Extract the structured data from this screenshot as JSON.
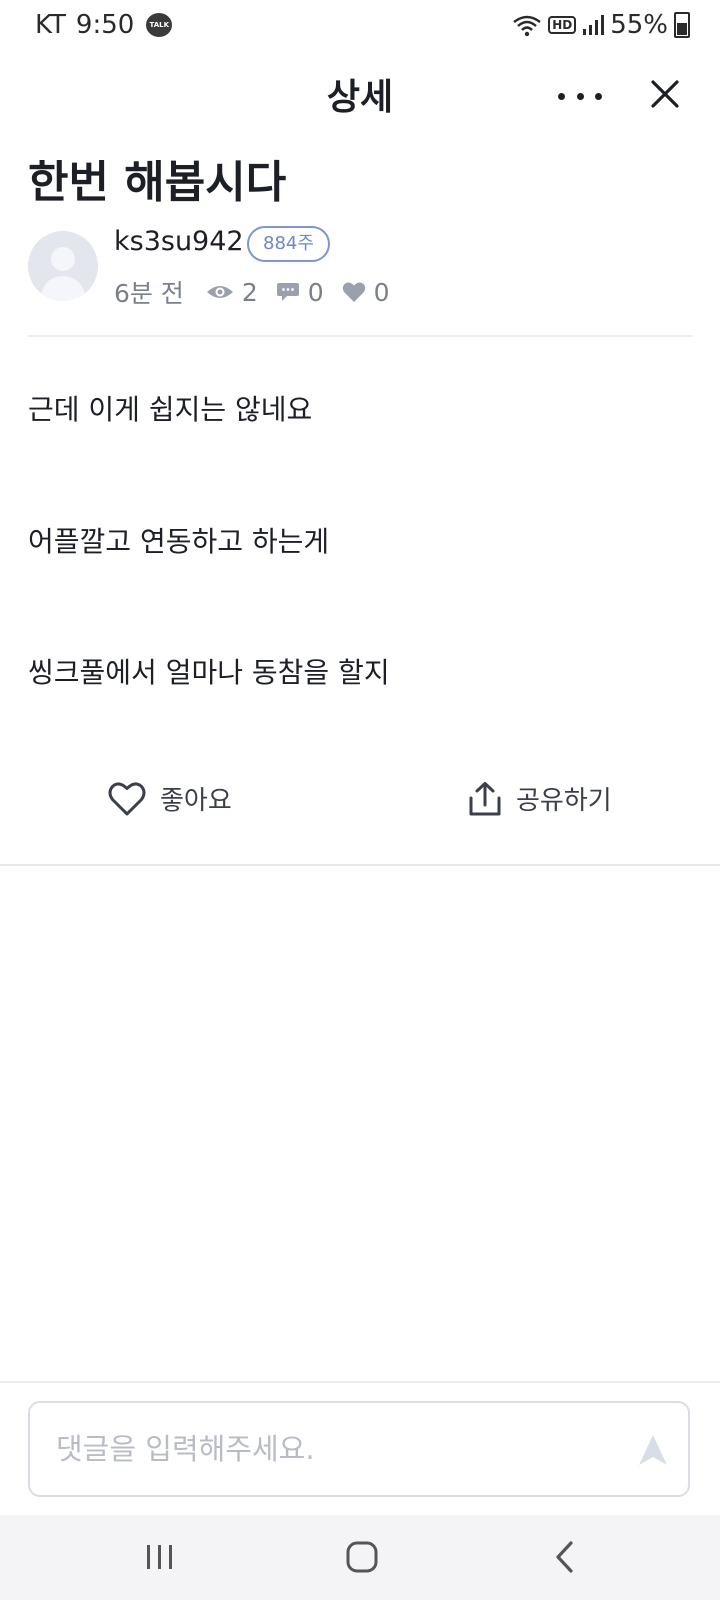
{
  "status_bar": {
    "carrier": "KT",
    "time": "9:50",
    "talk_badge": "TALK",
    "hd_label": "HD",
    "battery": "55%"
  },
  "header": {
    "title": "상세"
  },
  "post": {
    "title": "한번 해봅시다",
    "author": "ks3su942",
    "author_badge": "884주",
    "time": "6분 전",
    "views": "2",
    "comments": "0",
    "likes": "0",
    "body_lines": [
      "근데 이게 쉽지는 않네요",
      "어플깔고 연동하고 하는게",
      "씽크풀에서 얼마나 동참을 할지"
    ]
  },
  "actions": {
    "like_label": "좋아요",
    "share_label": "공유하기"
  },
  "comment": {
    "placeholder": "댓글을 입력해주세요.",
    "value": ""
  },
  "icons": {
    "views": "eye-icon",
    "comments": "speech-bubble-icon",
    "likes": "heart-icon",
    "like_action": "heart-outline-icon",
    "share_action": "share-icon",
    "send": "send-icon",
    "more": "more-dots-icon",
    "close": "close-icon"
  },
  "colors": {
    "text_primary": "#1d1f26",
    "text_muted": "#7a7f8c",
    "badge_accent": "#6d88c6",
    "icon_muted": "#9aa0ad",
    "placeholder": "#b8bcc6"
  }
}
